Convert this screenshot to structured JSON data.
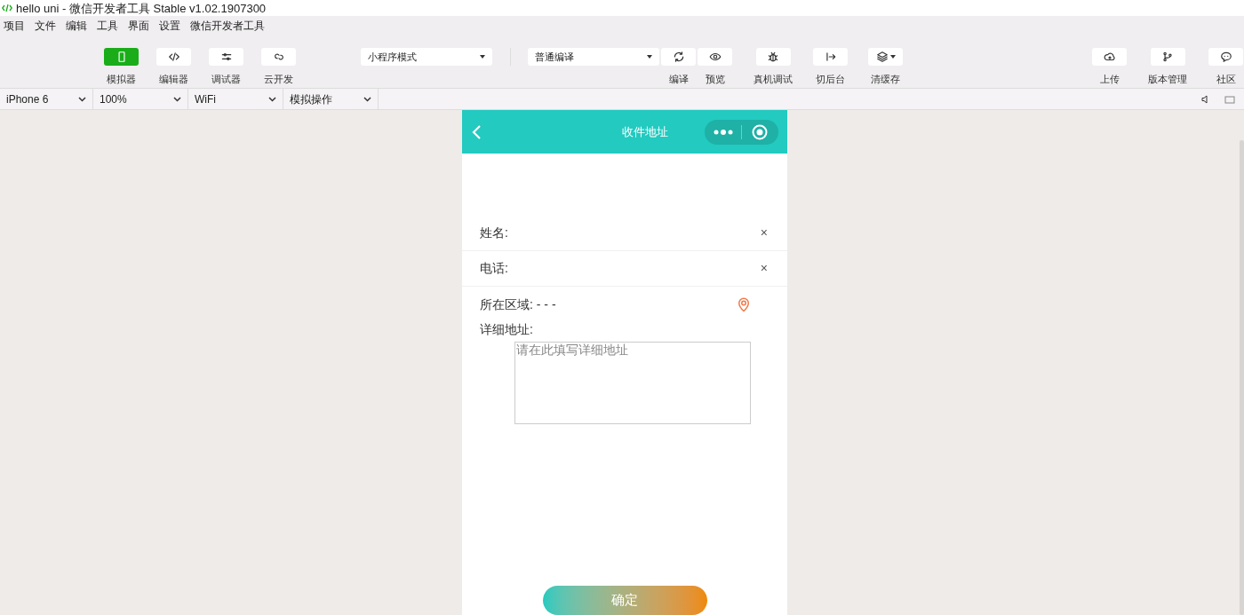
{
  "window": {
    "title": "hello uni - 微信开发者工具 Stable v1.02.1907300"
  },
  "menu": [
    "项目",
    "文件",
    "编辑",
    "工具",
    "界面",
    "设置",
    "微信开发者工具"
  ],
  "toolbar": {
    "view_buttons": [
      {
        "label": "模拟器",
        "selected": true
      },
      {
        "label": "编辑器",
        "selected": false
      },
      {
        "label": "调试器",
        "selected": false
      },
      {
        "label": "云开发",
        "selected": false
      }
    ],
    "mode_select": "小程序模式",
    "compile_select": "普通编译",
    "actions": [
      {
        "label": "编译"
      },
      {
        "label": "预览"
      },
      {
        "label": "真机调试"
      },
      {
        "label": "切后台"
      },
      {
        "label": "清缓存"
      }
    ],
    "right_actions": [
      {
        "label": "上传"
      },
      {
        "label": "版本管理"
      },
      {
        "label": "社区"
      }
    ]
  },
  "device_bar": [
    "iPhone 6",
    "100%",
    "WiFi",
    "模拟操作"
  ],
  "phone": {
    "nav_title": "收件地址",
    "fields": [
      {
        "kind": "input",
        "label": "姓名:",
        "clear": "×"
      },
      {
        "kind": "input",
        "label": "电话:",
        "clear": "×"
      },
      {
        "kind": "region",
        "text": "所在区域: - - -"
      },
      {
        "kind": "textarea",
        "label": "详细地址:",
        "placeholder": "请在此填写详细地址"
      }
    ],
    "submit": "确定"
  }
}
